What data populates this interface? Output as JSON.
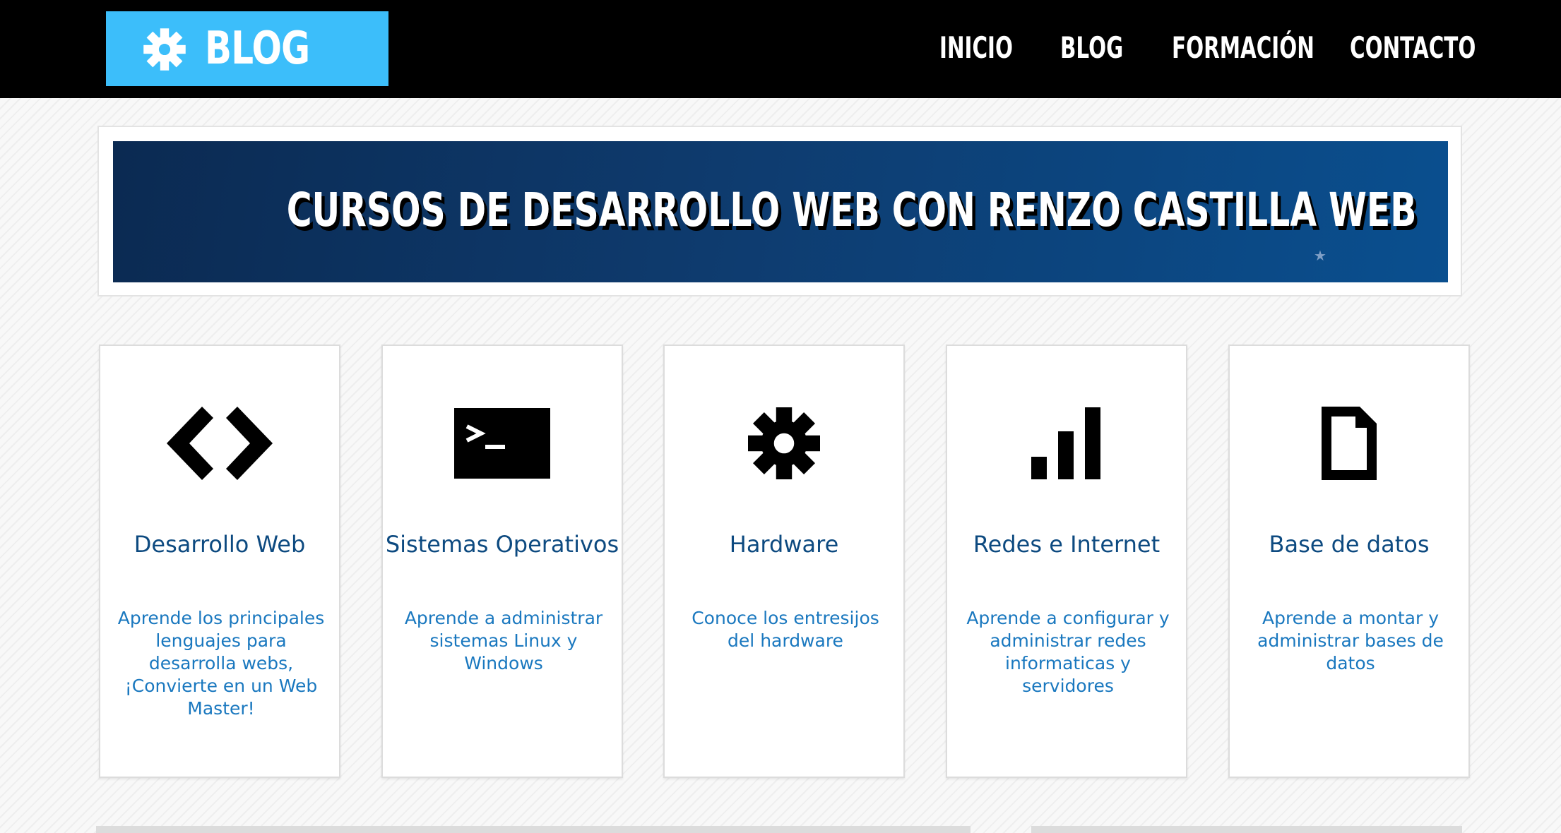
{
  "header": {
    "logo_text": "BLOG",
    "nav": [
      "INICIO",
      "BLOG",
      "FORMACIÓN",
      "CONTACTO"
    ]
  },
  "banner": {
    "title": "CURSOS DE DESARROLLO WEB CON RENZO CASTILLA WEB"
  },
  "cards": [
    {
      "icon": "code-icon",
      "title": "Desarrollo Web",
      "description": "Aprende los principales lenguajes para desarrolla webs, ¡Convierte en un Web Master!"
    },
    {
      "icon": "terminal-icon",
      "title": "Sistemas Operativos",
      "description": "Aprende a administrar sistemas Linux y Windows"
    },
    {
      "icon": "gear-icon",
      "title": "Hardware",
      "description": "Conoce los entresijos del hardware"
    },
    {
      "icon": "signal-bars-icon",
      "title": "Redes e Internet",
      "description": "Aprende a configurar y administrar redes informaticas y servidores"
    },
    {
      "icon": "file-icon",
      "title": "Base de datos",
      "description": "Aprende a montar y administrar bases de datos"
    }
  ],
  "colors": {
    "header_bg": "#000000",
    "logo_bg": "#3cbefa",
    "banner_bg": "#0e3b6e",
    "card_title": "#0d4a80",
    "card_text": "#1a78bf"
  }
}
